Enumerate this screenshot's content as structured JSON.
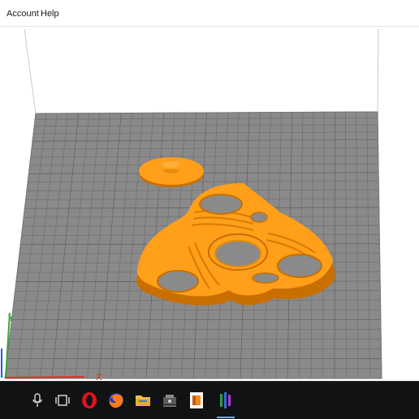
{
  "menubar": {
    "items": [
      {
        "id": "account",
        "label": "Account"
      },
      {
        "id": "help",
        "label": "Help"
      }
    ]
  },
  "viewport": {
    "plate_color": "#8a8a8a",
    "grid_line_color": "#6e6e6e",
    "model_color": "#ff9f1a",
    "model_dark_color": "#c96f00",
    "axis_colors": {
      "x": "#e0302a",
      "y": "#3aa63a",
      "z": "#2a55e0"
    },
    "objects": [
      {
        "name": "spinner-cap",
        "icon": "disc-with-knob"
      },
      {
        "name": "fidget-spinner",
        "icon": "tri-lobe-spinner"
      }
    ]
  },
  "taskbar": {
    "items": [
      {
        "name": "microphone",
        "icon": "microphone-icon"
      },
      {
        "name": "task-view",
        "icon": "task-view-icon"
      },
      {
        "name": "opera",
        "icon": "opera-icon",
        "color": "#e0131e"
      },
      {
        "name": "firefox",
        "icon": "firefox-icon",
        "color": "#ff7a1a"
      },
      {
        "name": "file-explorer",
        "icon": "folder-icon",
        "color": "#f2c14e"
      },
      {
        "name": "app-device",
        "icon": "device-icon"
      },
      {
        "name": "app-orange",
        "icon": "orange-app-icon",
        "color": "#f08a1c"
      },
      {
        "name": "app-bars",
        "icon": "bars-app-icon",
        "active": true
      }
    ]
  }
}
